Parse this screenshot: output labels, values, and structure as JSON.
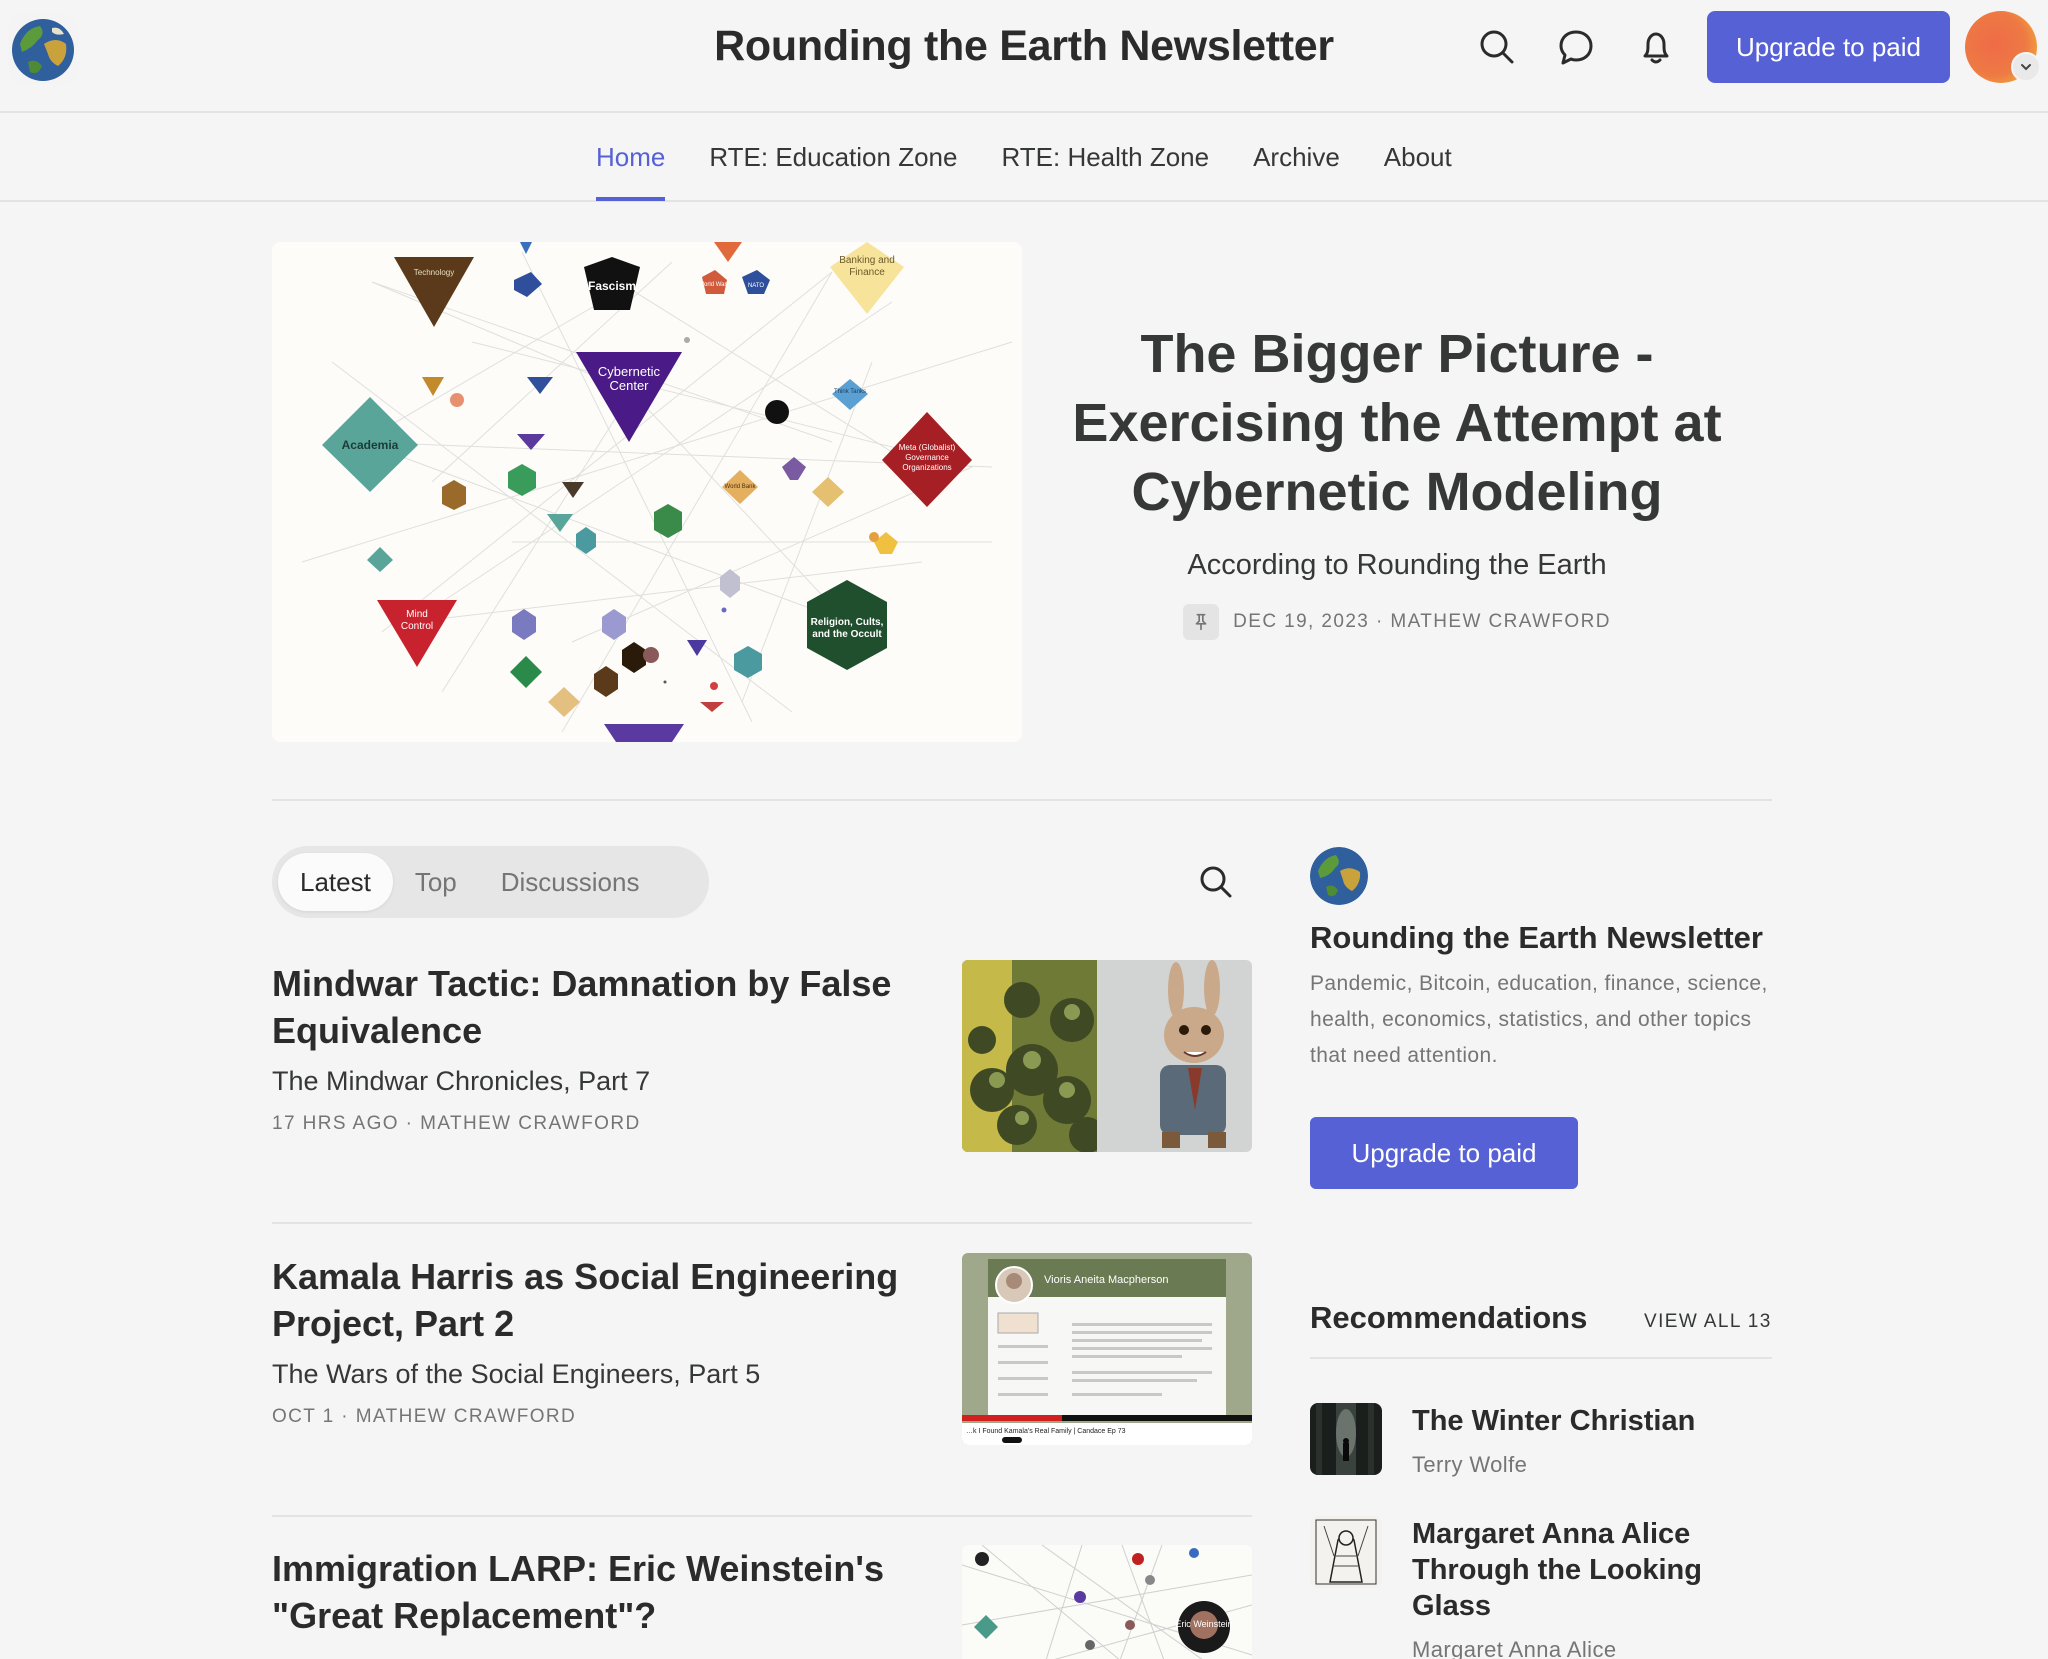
{
  "header": {
    "site_title": "Rounding the Earth Newsletter",
    "upgrade_label": "Upgrade to paid"
  },
  "nav": {
    "items": [
      "Home",
      "RTE: Education Zone",
      "RTE: Health Zone",
      "Archive",
      "About"
    ],
    "active": "Home"
  },
  "hero": {
    "title": "The Bigger Picture - Exercising the Attempt at Cybernetic Modeling",
    "subtitle": "According to Rounding the Earth",
    "date": "DEC 19, 2023",
    "author": "MATHEW CRAWFORD",
    "diagram_labels": {
      "technology": "Technology",
      "fascism": "Fascism",
      "banking": "Banking and Finance",
      "cybernetic": "Cybernetic Center",
      "academia": "Academia",
      "meta": "Meta (Globalist) Governance Organizations",
      "mind_control": "Mind Control",
      "religion": "Religion, Cults, and the Occult",
      "nato": "NATO",
      "world_wars": "World Wars",
      "think_tanks": "Think Tanks",
      "world_bank": "World Bank"
    }
  },
  "tabs": {
    "items": [
      "Latest",
      "Top",
      "Discussions"
    ],
    "active": "Latest"
  },
  "posts": [
    {
      "title": "Mindwar Tactic: Damnation by False Equivalence",
      "subtitle": "The Mindwar Chronicles, Part 7",
      "time": "17 HRS AGO",
      "author": "MATHEW CRAWFORD"
    },
    {
      "title": "Kamala Harris as Social Engineering Project, Part 2",
      "subtitle": "The Wars of the Social Engineers, Part 5",
      "time": "OCT 1",
      "author": "MATHEW CRAWFORD",
      "thumb_text": "Vioris Aneita Macpherson",
      "thumb_caption": "…k I Found Kamala's Real Family | Candace Ep 73"
    },
    {
      "title": "Immigration LARP: Eric Weinstein's \"Great Replacement\"?",
      "thumb_text": "Eric Weinstein"
    }
  ],
  "sidebar": {
    "title": "Rounding the Earth Newsletter",
    "description": "Pandemic, Bitcoin, education, finance, science, health, economics, statistics, and other topics that need attention.",
    "upgrade_label": "Upgrade to paid",
    "recommendations_label": "Recommendations",
    "view_all_label": "VIEW ALL 13",
    "recommendations": [
      {
        "name": "The Winter Christian",
        "author": "Terry Wolfe"
      },
      {
        "name": "Margaret Anna Alice Through the Looking Glass",
        "author": "Margaret Anna Alice"
      }
    ]
  },
  "colors": {
    "accent": "#5761d6",
    "background": "#f5f5f5",
    "text": "#363737",
    "muted": "#757575"
  },
  "icons": {
    "logo": "earth-globe-icon",
    "search": "search-icon",
    "chat": "chat-bubble-icon",
    "notifications": "bell-icon",
    "pin": "pin-icon",
    "chevron": "chevron-down-icon"
  }
}
